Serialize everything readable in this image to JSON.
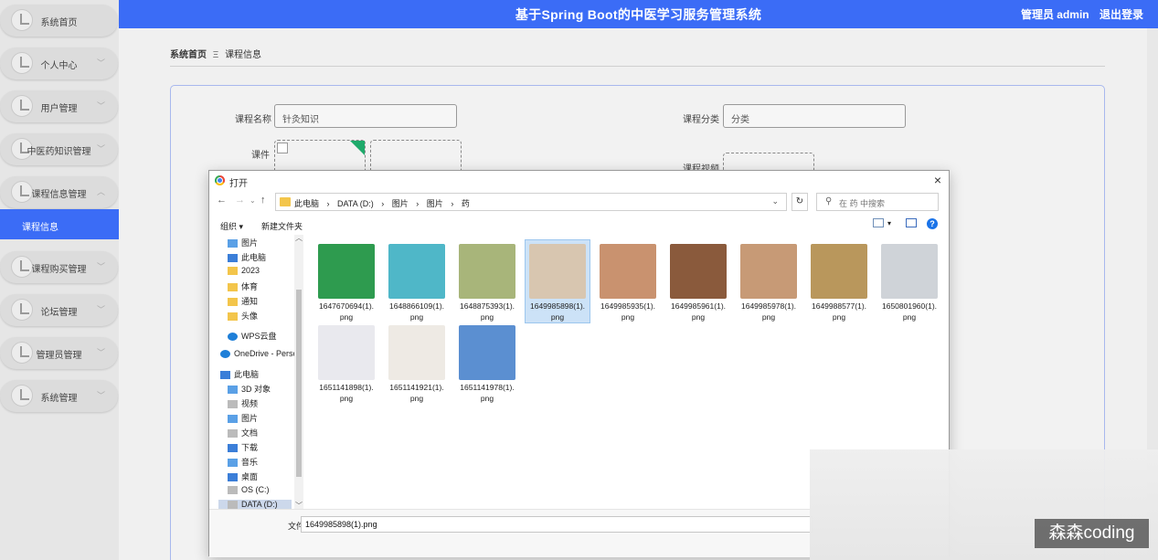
{
  "header": {
    "title": "基于Spring Boot的中医学习服务管理系统",
    "user": "管理员 admin",
    "logout": "退出登录"
  },
  "sidebar": {
    "items": [
      {
        "label": "系统首页"
      },
      {
        "label": "个人中心"
      },
      {
        "label": "用户管理"
      },
      {
        "label": "中医药知识管理"
      },
      {
        "label": "课程信息管理"
      },
      {
        "label": "课程购买管理"
      },
      {
        "label": "论坛管理"
      },
      {
        "label": "管理员管理"
      },
      {
        "label": "系统管理"
      }
    ],
    "active_sub": "课程信息"
  },
  "breadcrumb": {
    "home": "系统首页",
    "separator": "Ξ",
    "current": "课程信息"
  },
  "form": {
    "course_name_label": "课程名称",
    "course_name_value": "针灸知识",
    "category_label": "课程分类",
    "category_value": "分类",
    "courseware_label": "课件",
    "video_label": "课程视频"
  },
  "dialog": {
    "title": "打开",
    "close": "×",
    "path": [
      "此电脑",
      "›",
      "DATA (D:)",
      "›",
      "图片",
      "›",
      "图片",
      "›",
      "药"
    ],
    "search_placeholder": "在 药 中搜索",
    "organize": "组织 ▾",
    "new_folder": "新建文件夹",
    "help": "?",
    "nav_items": [
      {
        "label": "图片",
        "icon": "pictures-icon"
      },
      {
        "label": "此电脑",
        "icon": "pc-icon"
      },
      {
        "label": "2023",
        "icon": "folder-icon"
      },
      {
        "label": "体育",
        "icon": "folder-icon"
      },
      {
        "label": "通知",
        "icon": "folder-icon"
      },
      {
        "label": "头像",
        "icon": "folder-icon"
      },
      {
        "label": "WPS云盘",
        "icon": "cloud-icon"
      },
      {
        "label": "OneDrive - Perso",
        "icon": "cloud-icon"
      },
      {
        "label": "此电脑",
        "icon": "pc-icon"
      },
      {
        "label": "3D 对象",
        "icon": "3d-icon"
      },
      {
        "label": "视频",
        "icon": "video-icon"
      },
      {
        "label": "图片",
        "icon": "pictures-icon"
      },
      {
        "label": "文档",
        "icon": "document-icon"
      },
      {
        "label": "下载",
        "icon": "download-icon"
      },
      {
        "label": "音乐",
        "icon": "music-icon"
      },
      {
        "label": "桌面",
        "icon": "desktop-icon"
      },
      {
        "label": "OS (C:)",
        "icon": "drive-icon"
      },
      {
        "label": "DATA (D:)",
        "icon": "drive-icon"
      }
    ],
    "files": [
      {
        "line1": "1647670694(1).",
        "line2": "png",
        "color": "#2e9b4f"
      },
      {
        "line1": "1648866109(1).",
        "line2": "png",
        "color": "#4fb7c8"
      },
      {
        "line1": "1648875393(1).",
        "line2": "png",
        "color": "#a8b57a"
      },
      {
        "line1": "1649985898(1).",
        "line2": "png",
        "color": "#d8c6b0"
      },
      {
        "line1": "1649985935(1).",
        "line2": "png",
        "color": "#c9926f"
      },
      {
        "line1": "1649985961(1).",
        "line2": "png",
        "color": "#8a5a3c"
      },
      {
        "line1": "1649985978(1).",
        "line2": "png",
        "color": "#c79a76"
      },
      {
        "line1": "1649988577(1).",
        "line2": "png",
        "color": "#b9975c"
      },
      {
        "line1": "1650801960(1).",
        "line2": "png",
        "color": "#cfd3d8"
      },
      {
        "line1": "1651141898(1).",
        "line2": "png",
        "color": "#e9e9ee"
      },
      {
        "line1": "1651141921(1).",
        "line2": "png",
        "color": "#eeeae4"
      },
      {
        "line1": "1651141978(1).",
        "line2": "png",
        "color": "#5b8fd1"
      }
    ],
    "filename_label": "文件名(N):",
    "filename_value": "1649985898(1).png"
  },
  "watermark": "森森coding"
}
